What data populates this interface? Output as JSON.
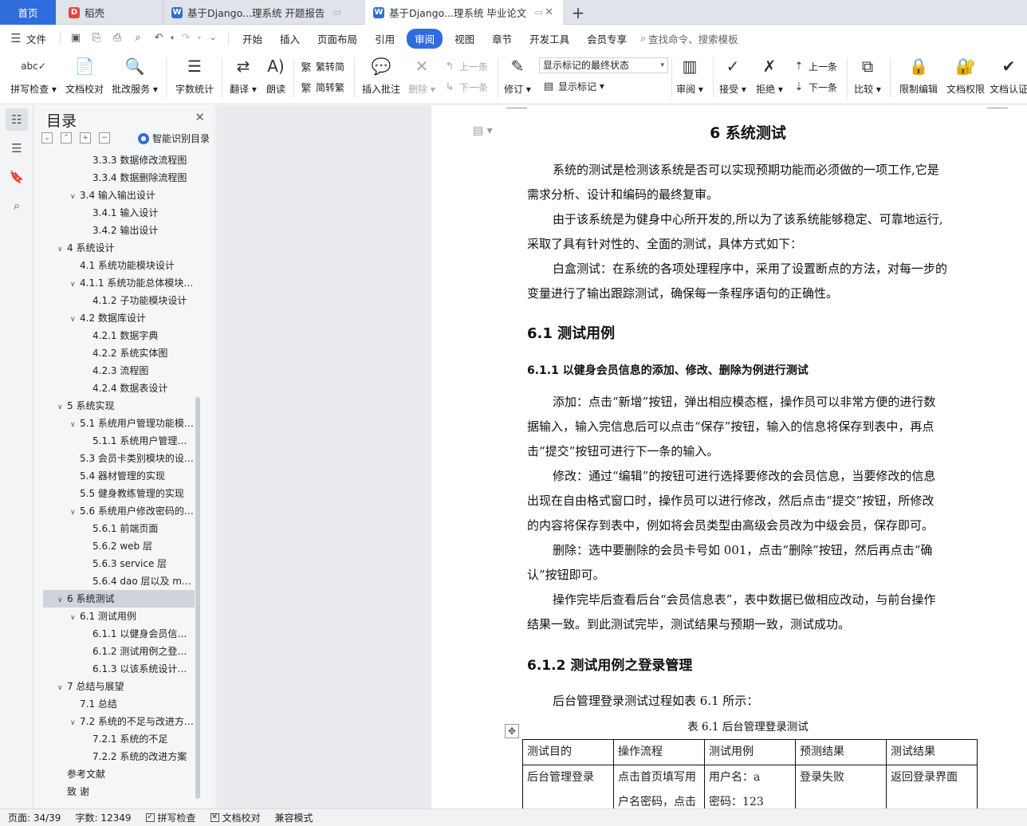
{
  "tabs": {
    "home": "首页",
    "daoke": "稻壳",
    "doc1": "基于Django...理系统 开题报告",
    "doc2": "基于Django...理系统 毕业论文"
  },
  "menu": {
    "file": "文件",
    "items": [
      "开始",
      "插入",
      "页面布局",
      "引用",
      "审阅",
      "视图",
      "章节",
      "开发工具",
      "会员专享"
    ],
    "active": "审阅",
    "search": "查找命令、搜索模板"
  },
  "ribbon": {
    "spellcheck": "拼写检查",
    "proofread": "文档校对",
    "correction_service": "批改服务",
    "word_count": "字数统计",
    "translate": "翻译",
    "read_aloud": "朗读",
    "to_traditional": "繁转简",
    "to_simplified": "简转繁",
    "insert_comment": "插入批注",
    "delete": "删除",
    "prev_comment": "上一条",
    "next_comment": "下一条",
    "track_changes": "修订",
    "markup_state": "显示标记的最终状态",
    "show_markup": "显示标记",
    "review": "审阅",
    "accept": "接受",
    "reject": "拒绝",
    "prev_change": "上一条",
    "next_change": "下一条",
    "compare": "比较",
    "restrict_editing": "限制编辑",
    "doc_permissions": "文档权限",
    "doc_certify": "文档认证"
  },
  "toc": {
    "title": "目录",
    "smart": "智能识别目录",
    "items": [
      {
        "text": "3.3.3 数据修改流程图",
        "level": 3,
        "caret": false
      },
      {
        "text": "3.3.4 数据删除流程图",
        "level": 3,
        "caret": false
      },
      {
        "text": "3.4 输入输出设计",
        "level": 2,
        "caret": true
      },
      {
        "text": "3.4.1 输入设计",
        "level": 3,
        "caret": false
      },
      {
        "text": "3.4.2 输出设计",
        "level": 3,
        "caret": false
      },
      {
        "text": "4  系统设计",
        "level": 1,
        "caret": true
      },
      {
        "text": "4.1 系统功能模块设计",
        "level": 2,
        "caret": false
      },
      {
        "text": "4.1.1 系统功能总体模块 ...",
        "level": 2,
        "caret": true
      },
      {
        "text": "4.1.2 子功能模块设计",
        "level": 3,
        "caret": false
      },
      {
        "text": "4.2 数据库设计",
        "level": 2,
        "caret": true
      },
      {
        "text": "4.2.1 数据字典",
        "level": 3,
        "caret": false
      },
      {
        "text": "4.2.2 系统实体图",
        "level": 3,
        "caret": false
      },
      {
        "text": "4.2.3 流程图",
        "level": 3,
        "caret": false
      },
      {
        "text": "4.2.4 数据表设计",
        "level": 3,
        "caret": false
      },
      {
        "text": "5  系统实现",
        "level": 1,
        "caret": true
      },
      {
        "text": "5.1 系统用户管理功能模 ...",
        "level": 2,
        "caret": true
      },
      {
        "text": "5.1.1 系统用户管理功 ...",
        "level": 3,
        "caret": false
      },
      {
        "text": "5.3 会员卡类别模块的设 ...",
        "level": 2,
        "caret": false
      },
      {
        "text": "5.4 器材管理的实现",
        "level": 2,
        "caret": false
      },
      {
        "text": "5.5 健身教练管理的实现",
        "level": 2,
        "caret": false
      },
      {
        "text": "5.6 系统用户修改密码的 ...",
        "level": 2,
        "caret": true
      },
      {
        "text": "5.6.1  前端页面",
        "level": 3,
        "caret": false
      },
      {
        "text": "5.6.2 web 层",
        "level": 3,
        "caret": false
      },
      {
        "text": "5.6.3 service 层",
        "level": 3,
        "caret": false
      },
      {
        "text": "5.6.4 dao 层以及 ma ...",
        "level": 3,
        "caret": false
      },
      {
        "text": "6  系统测试",
        "level": 1,
        "caret": true,
        "highlight": true
      },
      {
        "text": "6.1 测试用例",
        "level": 2,
        "caret": true
      },
      {
        "text": "6.1.1  以健身会员信息 ...",
        "level": 3,
        "caret": false
      },
      {
        "text": "6.1.2  测试用例之登录 ...",
        "level": 3,
        "caret": false
      },
      {
        "text": "6.1.3  以该系统设计的 ...",
        "level": 3,
        "caret": false
      },
      {
        "text": "7  总结与展望",
        "level": 1,
        "caret": true
      },
      {
        "text": "7.1  总结",
        "level": 2,
        "caret": false
      },
      {
        "text": "7.2 系统的不足与改进方 ...",
        "level": 2,
        "caret": true
      },
      {
        "text": "7.2.1  系统的不足",
        "level": 3,
        "caret": false
      },
      {
        "text": "7.2.2  系统的改进方案",
        "level": 3,
        "caret": false
      },
      {
        "text": "参考文献",
        "level": 1,
        "caret": false
      },
      {
        "text": "致    谢",
        "level": 1,
        "caret": false
      }
    ]
  },
  "document": {
    "chapter_title": "6  系统测试",
    "intro_lines": [
      "系统的测试是检测该系统是否可以实现预期功能而必须做的一项工作,它是",
      "需求分析、设计和编码的最终复审。",
      "由于该系统是为健身中心所开发的,所以为了该系统能够稳定、可靠地运行,",
      "采取了具有针对性的、全面的测试，具体方式如下：",
      "白盒测试：在系统的各项处理程序中，采用了设置断点的方法，对每一步的",
      "变量进行了输出跟踪测试，确保每一条程序语句的正确性。"
    ],
    "section_6_1": "6.1 测试用例",
    "section_6_1_1": "6.1.1  以健身会员信息的添加、修改、删除为例进行测试",
    "body_lines": [
      "添加：点击“新增”按钮，弹出相应模态框，操作员可以非常方便的进行数",
      "据输入，输入完信息后可以点击“保存”按钮，输入的信息将保存到表中，再点",
      "击“提交”按钮可进行下一条的输入。",
      "修改：通过“编辑”的按钮可进行选择要修改的会员信息，当要修改的信息",
      "出现在自由格式窗口时，操作员可以进行修改，然后点击“提交”按钮，所修改",
      "的内容将保存到表中，例如将会员类型由高级会员改为中级会员，保存即可。",
      "删除：选中要删除的会员卡号如 001，点击“删除”按钮，然后再点击“确",
      "认”按钮即可。",
      "操作完毕后查看后台“会员信息表”，表中数据已做相应改动，与前台操作",
      "结果一致。到此测试完毕，测试结果与预期一致，测试成功。"
    ],
    "section_6_1_2": "6.1.2  测试用例之登录管理",
    "table_intro": "后台管理登录测试过程如表 6.1 所示：",
    "table_caption": "表 6.1 后台管理登录测试",
    "table_headers": [
      "测试目的",
      "操作流程",
      "测试用例",
      "预测结果",
      "测试结果"
    ],
    "table_row": [
      "后台管理登录",
      "点击首页填写用",
      "用户名：a",
      "登录失败",
      "返回登录界面"
    ],
    "table_row_line2": [
      "",
      "户名密码，点击",
      "密码：123",
      "",
      ""
    ]
  },
  "status": {
    "page": "页面: 34/39",
    "words": "字数: 12349",
    "spell": "拼写检查",
    "proof": "文档校对",
    "compat": "兼容模式"
  },
  "colors": {
    "accent": "#2f6ddc",
    "tab_bar": "#dfe3ea",
    "toc_highlight": "#cfd4dc"
  }
}
